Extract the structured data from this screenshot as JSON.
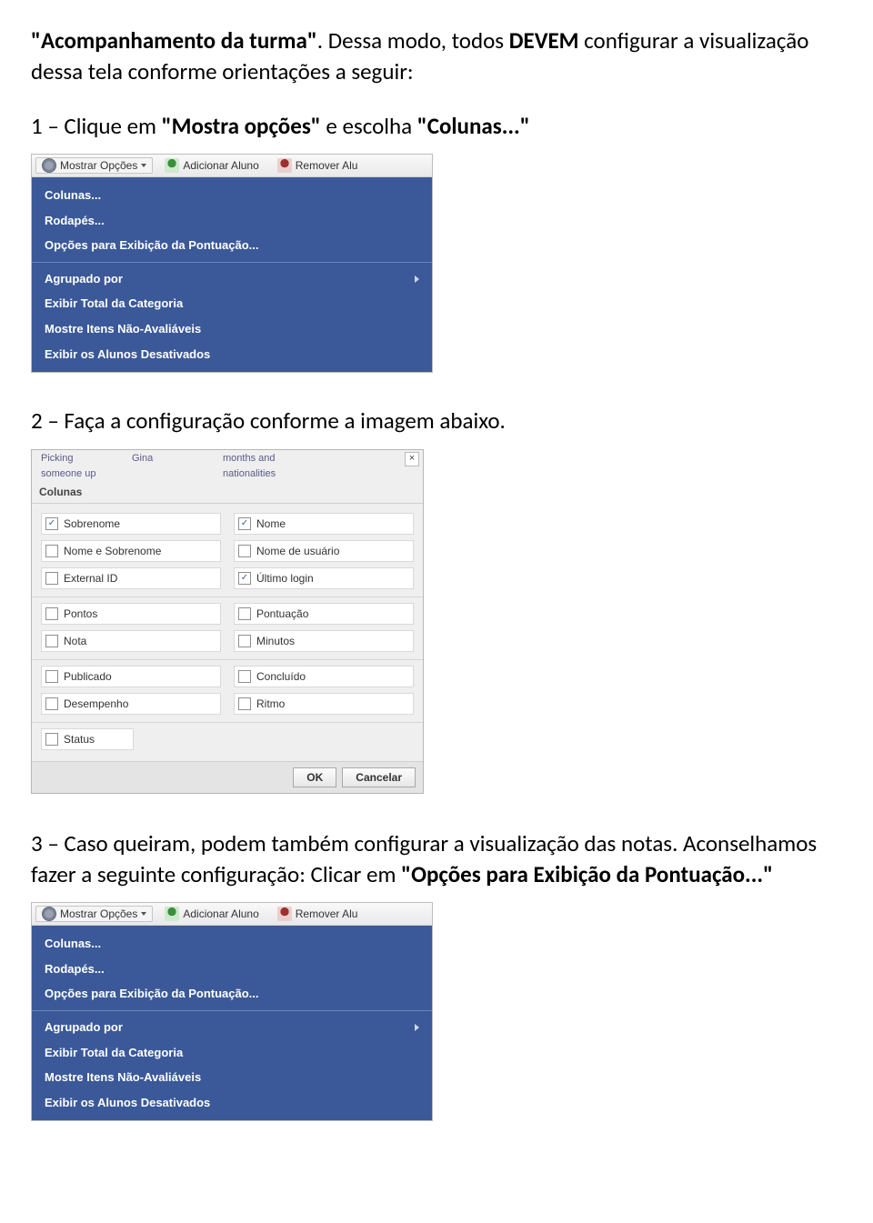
{
  "intro": {
    "quoted": "\"Acompanhamento da turma\"",
    "sentence_tail": ". Dessa modo, todos ",
    "devem": "DEVEM",
    "sentence_tail2": " configurar a visualização dessa tela conforme orientações a seguir:"
  },
  "step1": {
    "lead": "1 – Clique em ",
    "q1": "\"Mostra opções\"",
    "mid": " e escolha ",
    "q2": "\"Colunas...\""
  },
  "options_toolbar": {
    "mostrar_opcoes": "Mostrar Opções",
    "adicionar_aluno": "Adicionar Aluno",
    "remover_alu": "Remover Alu"
  },
  "options_menu": {
    "colunas": "Colunas...",
    "rodapes": "Rodapés...",
    "opcoes_pontuacao": "Opções para Exibição da Pontuação...",
    "agrupado_por": "Agrupado por",
    "exibir_total_categoria": "Exibir Total da Categoria",
    "mostre_itens_nao_avaliaveis": "Mostre Itens Não-Avaliáveis",
    "exibir_alunos_desativados": "Exibir os Alunos Desativados"
  },
  "step2": "2 – Faça a configuração conforme a imagem abaixo.",
  "colunas_dialog": {
    "title": "Colunas",
    "top_labels": {
      "picking": "Picking",
      "someone_up": "someone up",
      "gina": "Gina",
      "months_and": "months and",
      "nationalities": "nationalities"
    },
    "groups": [
      [
        {
          "label": "Sobrenome",
          "checked": true
        },
        {
          "label": "Nome",
          "checked": true
        },
        {
          "label": "Nome e Sobrenome",
          "checked": false
        },
        {
          "label": "Nome de usuário",
          "checked": false
        },
        {
          "label": "External ID",
          "checked": false
        },
        {
          "label": "Último login",
          "checked": true
        }
      ],
      [
        {
          "label": "Pontos",
          "checked": false
        },
        {
          "label": "Pontuação",
          "checked": false
        },
        {
          "label": "Nota",
          "checked": false
        },
        {
          "label": "Minutos",
          "checked": false
        }
      ],
      [
        {
          "label": "Publicado",
          "checked": false
        },
        {
          "label": "Concluído",
          "checked": false
        },
        {
          "label": "Desempenho",
          "checked": false
        },
        {
          "label": "Ritmo",
          "checked": false
        }
      ],
      [
        {
          "label": "Status",
          "checked": false
        }
      ]
    ],
    "buttons": {
      "ok": "OK",
      "cancel": "Cancelar"
    }
  },
  "step3": {
    "lead": "3 – Caso queiram, podem também configurar a visualização das notas. Aconselhamos fazer a seguinte configuração: Clicar em ",
    "q1": "\"Opções para Exibição da Pontuação...\""
  }
}
